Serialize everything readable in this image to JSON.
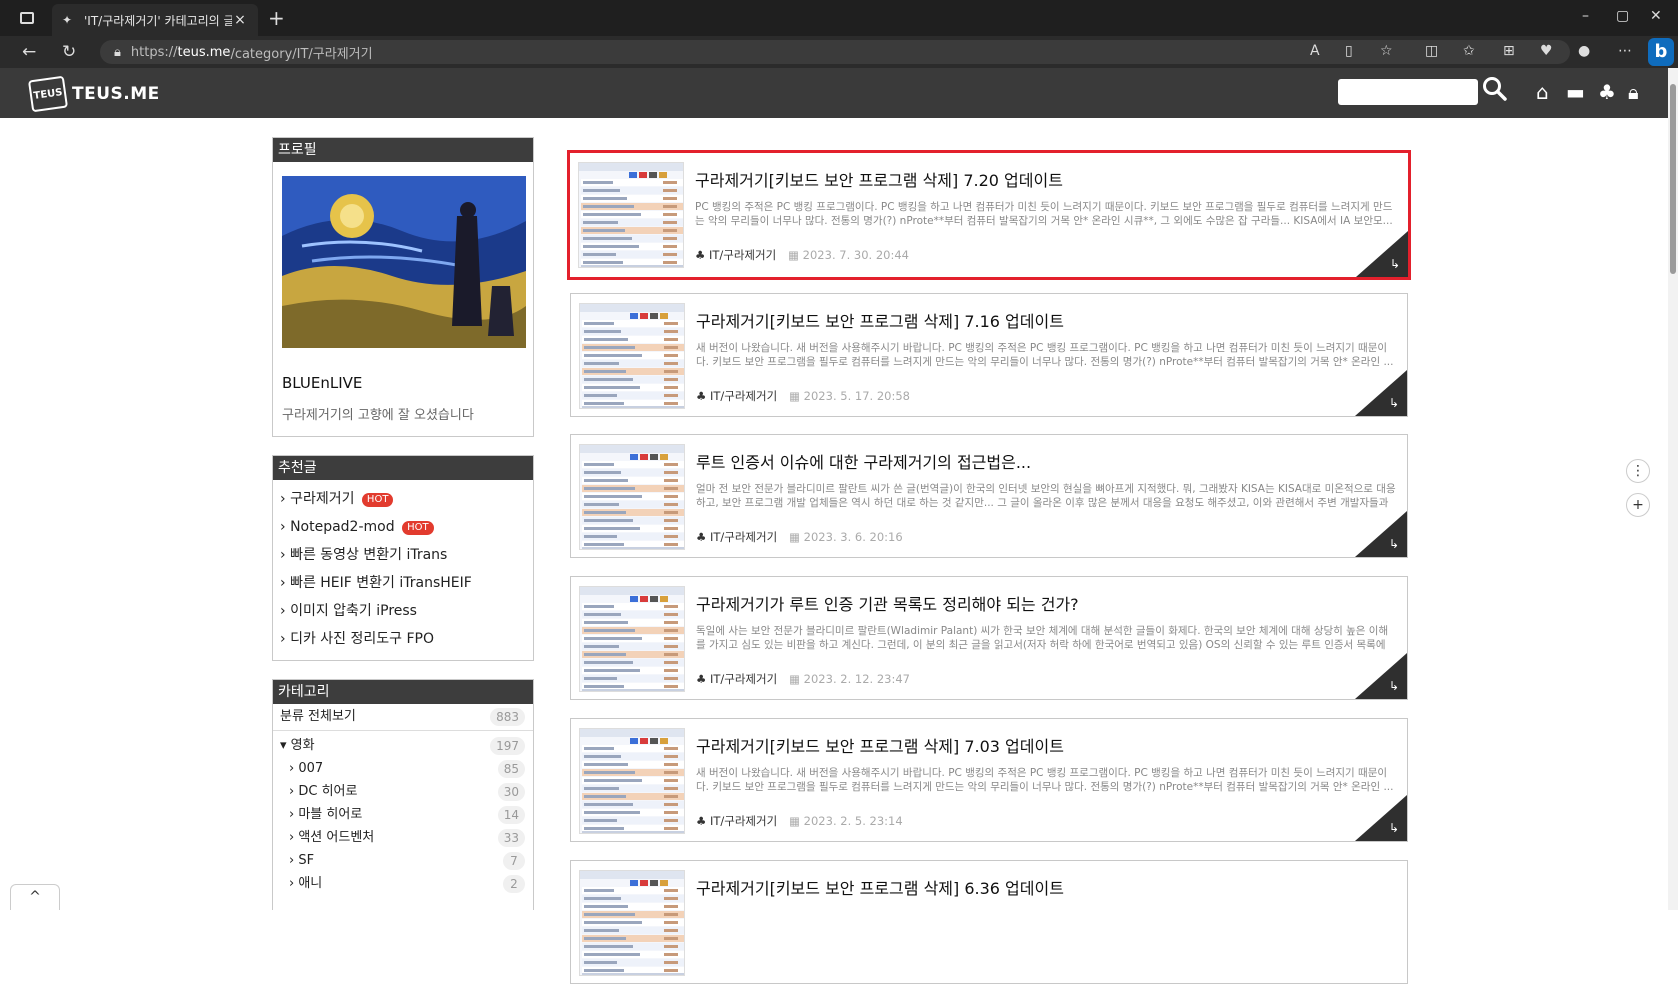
{
  "browser": {
    "tab_title": "'IT/구라제거기' 카테고리의 글 목",
    "tab_close": "×",
    "new_tab": "+",
    "url_prefix": "https://",
    "url_domain": "teus.me",
    "url_path": "/category/IT/구라제거기",
    "window_controls": [
      "–",
      "▢",
      "✕"
    ],
    "bing_label": "b"
  },
  "site": {
    "logo_mark": "TEUS",
    "logo_text": "TEUS.ME",
    "search_placeholder": ""
  },
  "sidebar": {
    "profile": {
      "heading": "프로필",
      "name": "BLUEnLIVE",
      "description": "구라제거기의 고향에 잘 오셨습니다"
    },
    "recommended": {
      "heading": "추천글",
      "items": [
        {
          "label": "구라제거기",
          "hot": "HOT"
        },
        {
          "label": "Notepad2-mod",
          "hot": "HOT"
        },
        {
          "label": "빠른 동영상 변환기 iTrans",
          "hot": ""
        },
        {
          "label": "빠른 HEIF 변환기 iTransHEIF",
          "hot": ""
        },
        {
          "label": "이미지 압축기 iPress",
          "hot": ""
        },
        {
          "label": "디카 사진 정리도구 FPO",
          "hot": ""
        }
      ]
    },
    "categories": {
      "heading": "카테고리",
      "all_label": "분류 전체보기",
      "all_count": "883",
      "group_label": "영화",
      "group_count": "197",
      "items": [
        {
          "label": "007",
          "count": "85"
        },
        {
          "label": "DC 히어로",
          "count": "30"
        },
        {
          "label": "마블 히어로",
          "count": "14"
        },
        {
          "label": "액션 어드벤처",
          "count": "33"
        },
        {
          "label": "SF",
          "count": "7"
        },
        {
          "label": "애니",
          "count": "2"
        }
      ]
    }
  },
  "posts": [
    {
      "title": "구라제거기[키보드 보안 프로그램 삭제] 7.20 업데이트",
      "excerpt": "PC 뱅킹의 주적은 PC 뱅킹 프로그램이다. PC 뱅킹을 하고 나면 컴퓨터가 미친 듯이 느려지기 때문이다. 키보드 보안 프로그램을 필두로 컴퓨터를 느려지게 만드는 악의 무리들이 너무나 많다. 전통의 명가(?) nProte**부터 컴퓨터 발목잡기의 거목 안* 온라인 시큐**, 그 외에도 수많은 잡 구라들... KISA에서 IA 보안모...",
      "category": "IT/구라제거기",
      "date": "2023. 7. 30. 20:44",
      "selected": true
    },
    {
      "title": "구라제거기[키보드 보안 프로그램 삭제] 7.16 업데이트",
      "excerpt": "새 버전이 나왔습니다. 새 버전을 사용해주시기 바랍니다. PC 뱅킹의 주적은 PC 뱅킹 프로그램이다. PC 뱅킹을 하고 나면 컴퓨터가 미친 듯이 느려지기 때문이다. 키보드 보안 프로그램을 필두로 컴퓨터를 느려지게 만드는 악의 무리들이 너무나 많다. 전통의 명가(?) nProte**부터 컴퓨터 발목잡기의 거목 안* 온라인 ...",
      "category": "IT/구라제거기",
      "date": "2023. 5. 17. 20:58",
      "selected": false
    },
    {
      "title": "루트 인증서 이슈에 대한 구라제거기의 접근법은...",
      "excerpt": "얼마 전 보안 전문가 블라디미르 팔란트 씨가 쓴 글(번역글)이 한국의 인터넷 보안의 현실을 뼈아프게 지적했다. 뭐, 그래봤자 KISA는 KISA대로 미온적으로 대응하고, 보안 프로그램 개발 업체들은 역시 하던 대로 하는 것 같지만... 그 글이 올라온 이후 많은 분께서 대응을 요청도 해주셨고, 이와 관련해서 주변 개발자들과 ...",
      "category": "IT/구라제거기",
      "date": "2023. 3. 6. 20:16",
      "selected": false
    },
    {
      "title": "구라제거기가 루트 인증 기관 목록도 정리해야 되는 건가?",
      "excerpt": "독일에 사는 보안 전문가 블라디미르 팔란트(Wladimir Palant) 씨가 한국 보안 체계에 대해 분석한 글들이 화제다. 한국의 보안 체계에 대해 상당히 높은 이해를 가지고 심도 있는 비판을 하고 계신다. 그런데, 이 분의 최근 글을 읽고서(저자 허락 하에 한국어로 번역되고 있음) OS의 신뢰할 수 있는 루트 인증서 목록에 왠...",
      "category": "IT/구라제거기",
      "date": "2023. 2. 12. 23:47",
      "selected": false
    },
    {
      "title": "구라제거기[키보드 보안 프로그램 삭제] 7.03 업데이트",
      "excerpt": "새 버전이 나왔습니다. 새 버전을 사용해주시기 바랍니다. PC 뱅킹의 주적은 PC 뱅킹 프로그램이다. PC 뱅킹을 하고 나면 컴퓨터가 미친 듯이 느려지기 때문이다. 키보드 보안 프로그램을 필두로 컴퓨터를 느려지게 만드는 악의 무리들이 너무나 많다. 전통의 명가(?) nProte**부터 컴퓨터 발목잡기의 거목 안* 온라인 ...",
      "category": "IT/구라제거기",
      "date": "2023. 2. 5. 23:14",
      "selected": false
    },
    {
      "title": "구라제거기[키보드 보안 프로그램 삭제] 6.36 업데이트",
      "excerpt": "",
      "category": "",
      "date": "",
      "selected": false
    }
  ],
  "floating": {
    "qr_label": "⋮",
    "plus_label": "+",
    "scroll_top_label": "^"
  },
  "colors": {
    "header_bg": "#3a3a3a",
    "selected_border": "#e3202c",
    "hot_badge": "#e23b2e"
  }
}
